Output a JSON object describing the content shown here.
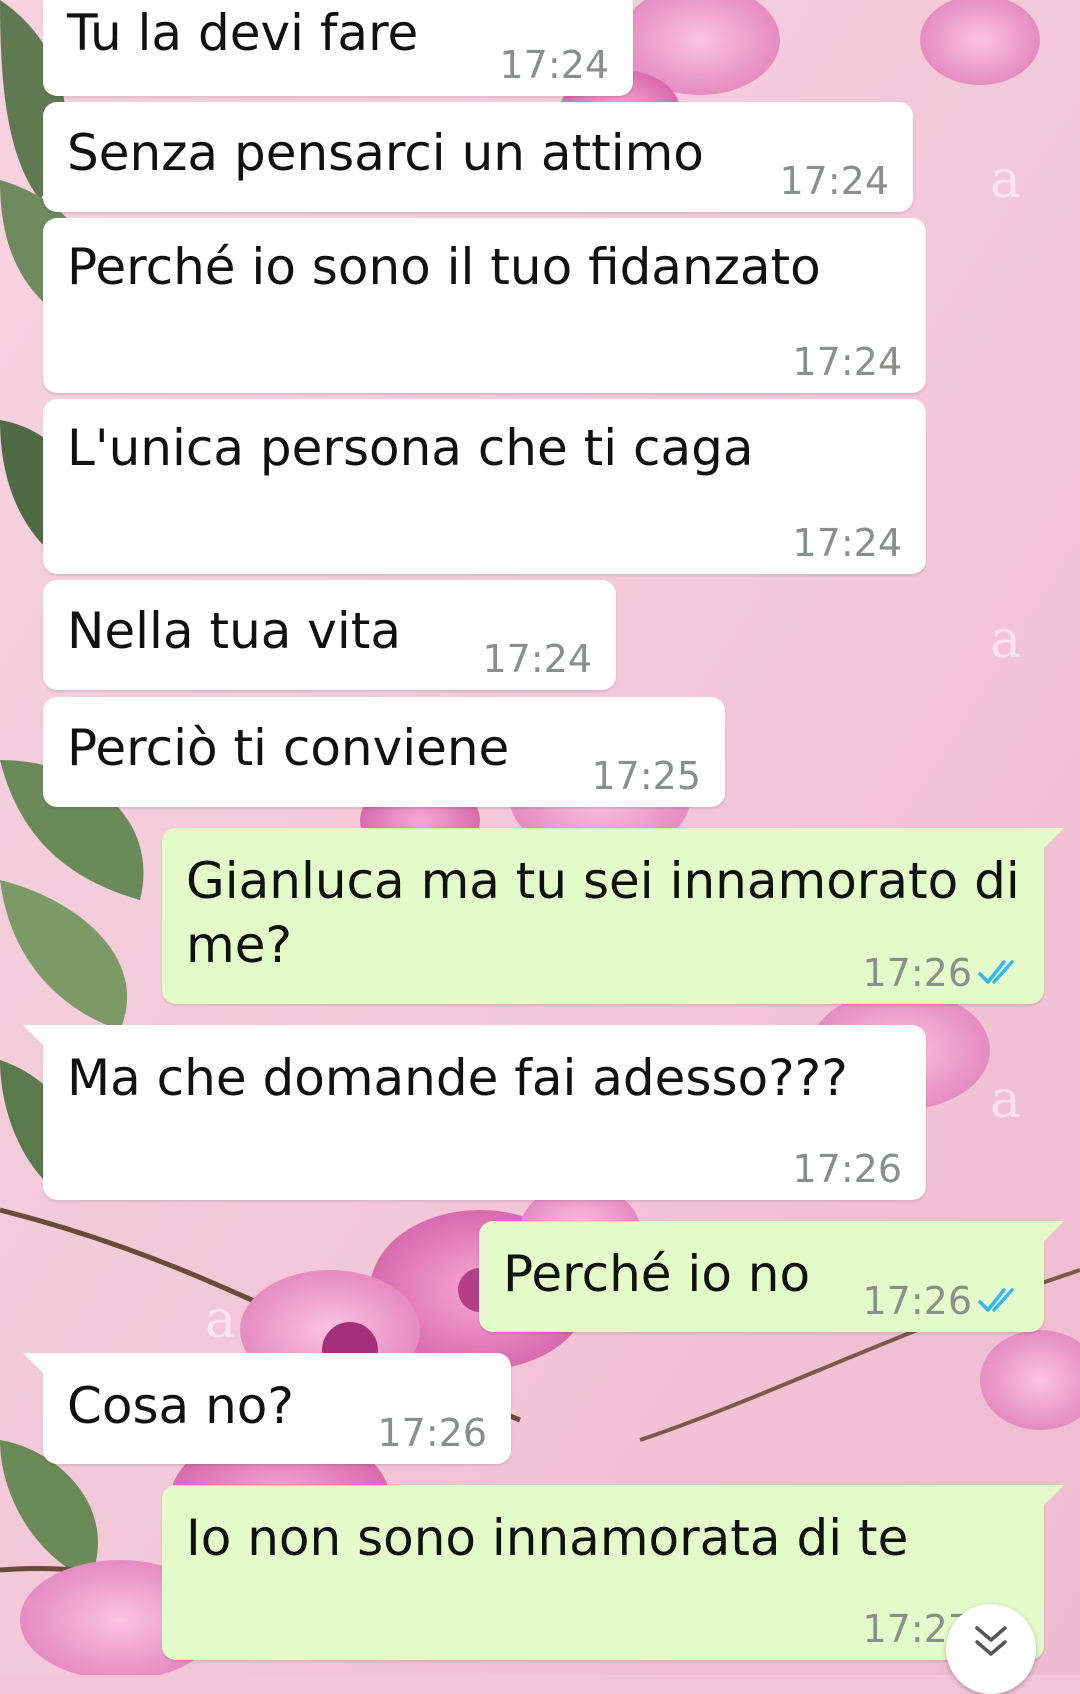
{
  "theme": {
    "incoming_bubble_color": "#ffffff",
    "outgoing_bubble_color": "#e3fbc9",
    "time_color": "#8a8f8c",
    "read_ticks_color": "#34b7f1"
  },
  "wallpaper": {
    "description_icon": "pink-flowers-wallpaper",
    "watermark_glyph": "a"
  },
  "messages": [
    {
      "direction": "incoming",
      "text": "Tu la devi fare",
      "time": "17:24"
    },
    {
      "direction": "incoming",
      "text": "Senza pensarci un attimo",
      "time": "17:24"
    },
    {
      "direction": "incoming",
      "text": "Perché io sono il tuo fidanzato",
      "time": "17:24"
    },
    {
      "direction": "incoming",
      "text": "L'unica persona che ti caga",
      "time": "17:24"
    },
    {
      "direction": "incoming",
      "text": "Nella tua vita",
      "time": "17:24"
    },
    {
      "direction": "incoming",
      "text": "Perciò ti conviene",
      "time": "17:25"
    },
    {
      "direction": "outgoing",
      "text_line1": "Gianluca ma tu sei innamorato di",
      "text_line2": "me?",
      "time": "17:26",
      "status": "read-double-check-icon"
    },
    {
      "direction": "incoming",
      "text": "Ma che domande fai adesso???",
      "time": "17:26"
    },
    {
      "direction": "outgoing",
      "text": "Perché io no",
      "time": "17:26",
      "status": "read-double-check-icon"
    },
    {
      "direction": "incoming",
      "text": "Cosa no?",
      "time": "17:26"
    },
    {
      "direction": "outgoing",
      "text": "Io non sono innamorata di te",
      "time": "17:27",
      "status": "read-double-check-icon"
    }
  ],
  "controls": {
    "scroll_down_icon": "double-chevron-down-icon"
  }
}
